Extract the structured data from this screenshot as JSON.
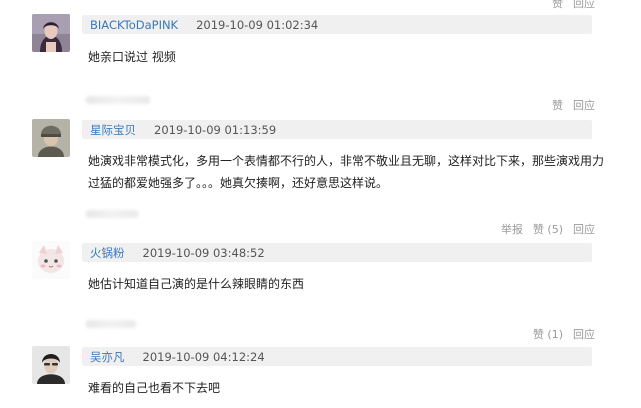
{
  "top_actions": {
    "like": "赞",
    "reply": "回应"
  },
  "comments": [
    {
      "username": "BIACKToDaPINK",
      "time": "2019-10-09 01:02:34",
      "text": "她亲口说过 视频",
      "actions": {
        "like": "赞",
        "reply": "回应"
      }
    },
    {
      "username": "星际宝贝",
      "time": "2019-10-09 01:13:59",
      "text": "她演戏非常模式化，多用一个表情都不行的人，非常不敬业且无聊，这样对比下来，那些演戏用力过猛的都爱她强多了。。。她真欠揍啊，还好意思这样说。",
      "actions": {
        "report": "举报",
        "like": "赞 (5)",
        "reply": "回应"
      }
    },
    {
      "username": "火锅粉",
      "time": "2019-10-09 03:48:52",
      "text": "她估计知道自己演的是什么辣眼睛的东西",
      "actions": {
        "like": "赞 (1)",
        "reply": "回应"
      }
    },
    {
      "username": "吴亦凡",
      "time": "2019-10-09 04:12:24",
      "text": "难看的自己也看不下去吧"
    }
  ]
}
